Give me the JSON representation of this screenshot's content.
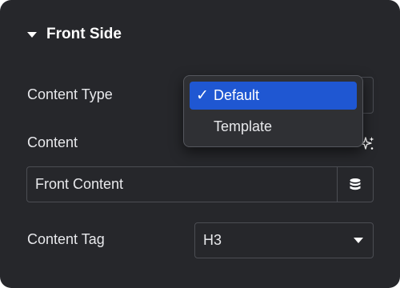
{
  "section": {
    "title": "Front Side",
    "icon": "caret-down-icon"
  },
  "content_type": {
    "label": "Content Type",
    "options": [
      "Default",
      "Template"
    ],
    "selected": "Default"
  },
  "content": {
    "label": "Content",
    "ai_icon": "sparkle-icon",
    "value": "Front Content",
    "dynamic_icon": "database-icon"
  },
  "content_tag": {
    "label": "Content Tag",
    "value": "H3",
    "icon": "caret-down-icon"
  },
  "colors": {
    "panel_background": "#26272b",
    "selected_option": "#1f57d2",
    "border": "#4b4d53",
    "text": "#e8e9ec"
  }
}
